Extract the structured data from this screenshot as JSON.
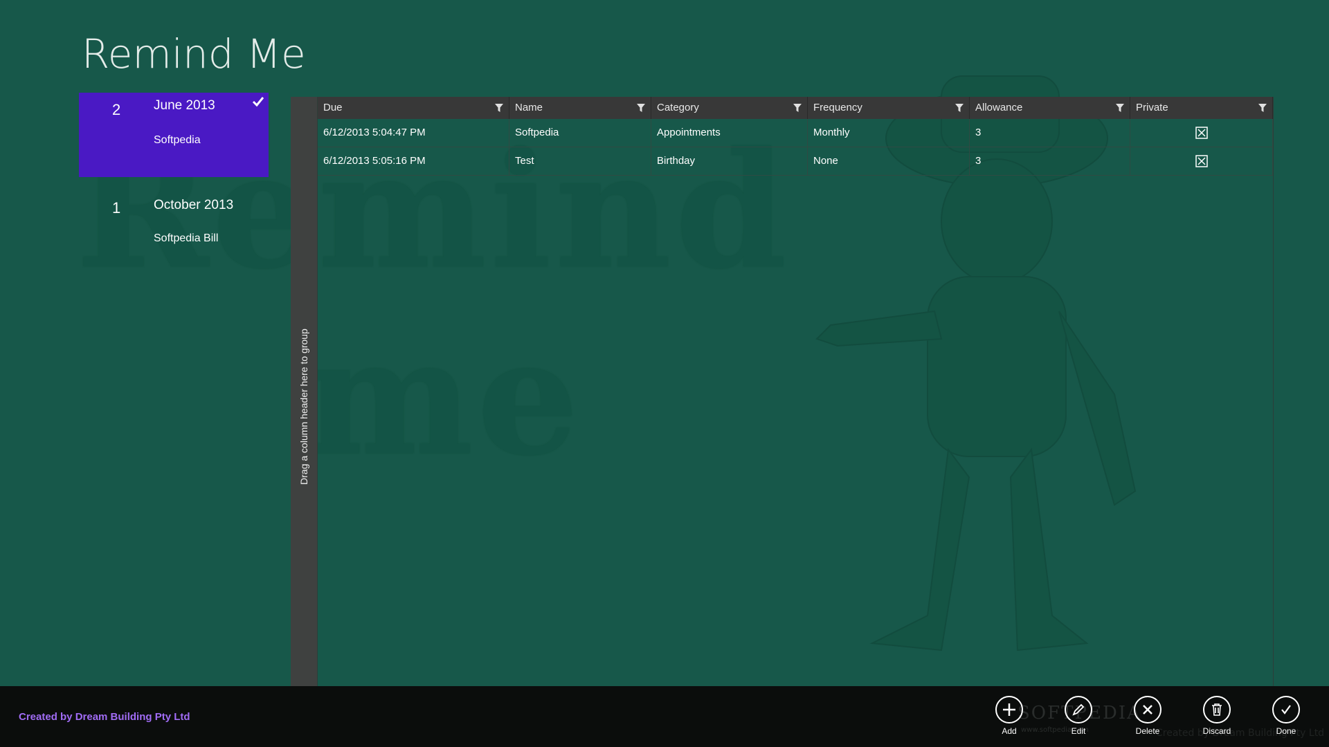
{
  "app": {
    "title": "Remind Me"
  },
  "groups": [
    {
      "count": "2",
      "month": "June 2013",
      "item": "Softpedia",
      "selected": true
    },
    {
      "count": "1",
      "month": "October 2013",
      "item": "Softpedia Bill",
      "selected": false
    }
  ],
  "grid": {
    "group_hint": "Drag a column header here to group",
    "columns": [
      "Due",
      "Name",
      "Category",
      "Frequency",
      "Allowance",
      "Private"
    ],
    "rows": [
      {
        "due": "6/12/2013 5:04:47 PM",
        "name": "Softpedia",
        "category": "Appointments",
        "frequency": "Monthly",
        "allowance": "3",
        "private": "checkbox-x-icon"
      },
      {
        "due": "6/12/2013 5:05:16 PM",
        "name": "Test",
        "category": "Birthday",
        "frequency": "None",
        "allowance": "3",
        "private": "checkbox-x-icon"
      }
    ]
  },
  "background": {
    "word1": "Remind",
    "word2": "me"
  },
  "app_bar": {
    "credit": "Created by Dream Building Pty Ltd",
    "watermark": "SOFTPEDIA",
    "watermark_url": "www.softpedia.com",
    "watermark_right": "Created by Dream Building Pty Ltd",
    "buttons": [
      {
        "label": "Add",
        "icon": "plus-icon"
      },
      {
        "label": "Edit",
        "icon": "pencil-icon"
      },
      {
        "label": "Delete",
        "icon": "x-icon"
      },
      {
        "label": "Discard",
        "icon": "trash-icon"
      },
      {
        "label": "Done",
        "icon": "check-icon"
      }
    ]
  },
  "colors": {
    "background": "#17584a",
    "selected_group": "#4a19c4",
    "credit_text": "#a16cf5",
    "app_bar": "#0b0d0c",
    "grid_header": "#383838"
  }
}
